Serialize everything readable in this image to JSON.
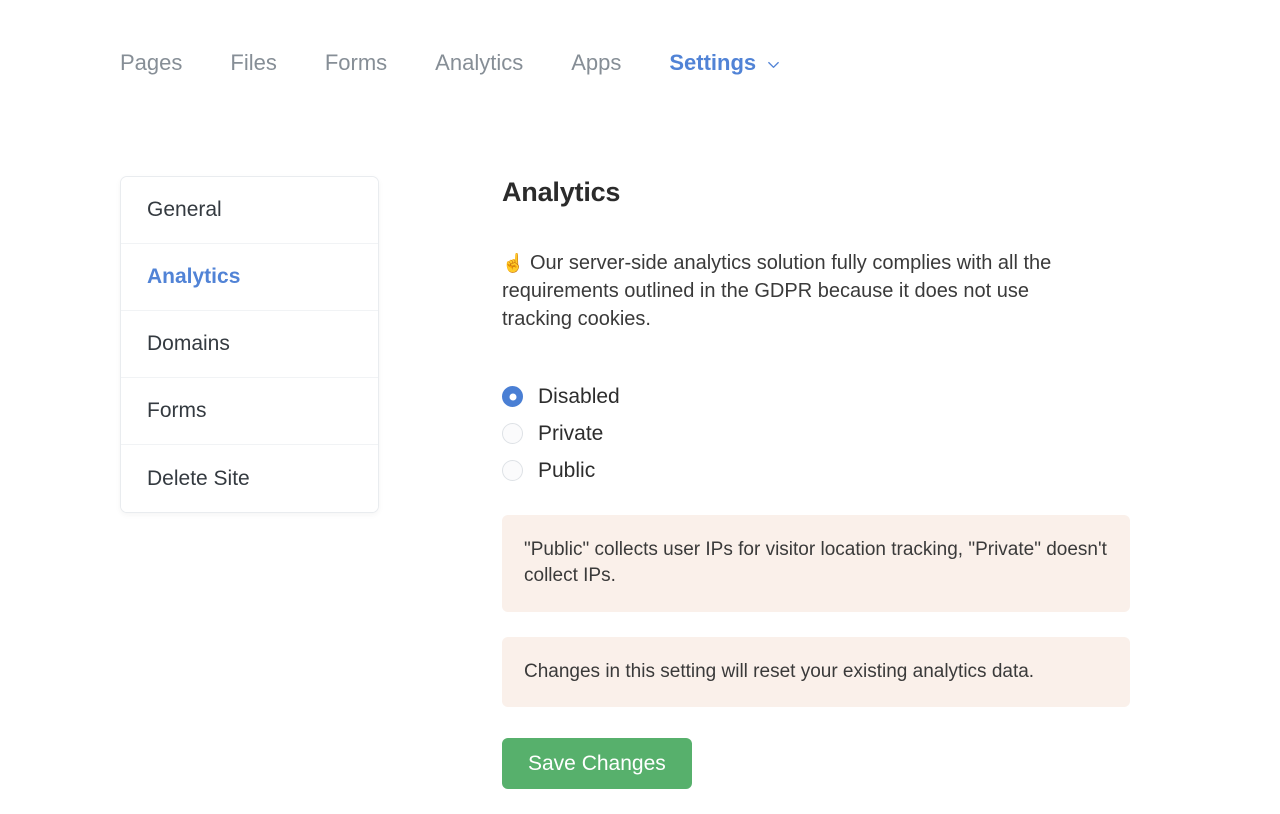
{
  "topnav": {
    "items": [
      {
        "label": "Pages",
        "active": false
      },
      {
        "label": "Files",
        "active": false
      },
      {
        "label": "Forms",
        "active": false
      },
      {
        "label": "Analytics",
        "active": false
      },
      {
        "label": "Apps",
        "active": false
      },
      {
        "label": "Settings",
        "active": true
      }
    ],
    "active_accent": "#5183d6",
    "inactive_color": "#868e96",
    "dropdown_icon": "chevron-down-icon"
  },
  "sidebar": {
    "items": [
      {
        "label": "General",
        "active": false
      },
      {
        "label": "Analytics",
        "active": true
      },
      {
        "label": "Domains",
        "active": false
      },
      {
        "label": "Forms",
        "active": false
      },
      {
        "label": "Delete Site",
        "active": false
      }
    ]
  },
  "main": {
    "title": "Analytics",
    "intro_emoji": "☝️",
    "intro_text": "Our server-side analytics solution fully complies with all the requirements outlined in the GDPR because it does not use tracking cookies.",
    "options": [
      {
        "label": "Disabled",
        "value": "disabled",
        "selected": true
      },
      {
        "label": "Private",
        "value": "private",
        "selected": false
      },
      {
        "label": "Public",
        "value": "public",
        "selected": false
      }
    ],
    "notices": [
      "\"Public\" collects user IPs for visitor location tracking, \"Private\" doesn't collect IPs.",
      "Changes in this setting will reset your existing analytics data."
    ],
    "save_label": "Save Changes",
    "save_color": "#57b06c",
    "notice_bg": "#faf0ea"
  }
}
